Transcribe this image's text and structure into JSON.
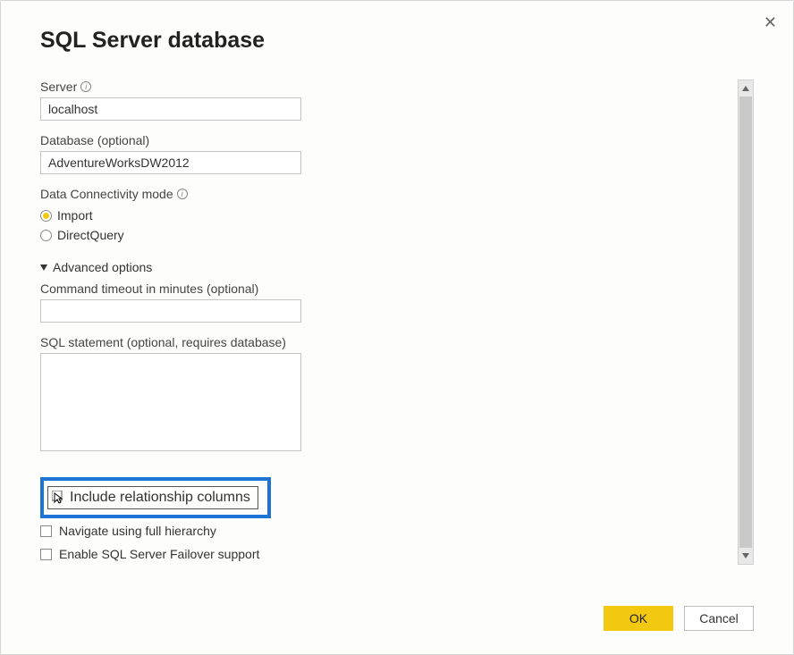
{
  "dialog": {
    "title": "SQL Server database"
  },
  "fields": {
    "server_label": "Server",
    "server_value": "localhost",
    "database_label": "Database (optional)",
    "database_value": "AdventureWorksDW2012",
    "connectivity_label": "Data Connectivity mode",
    "import_label": "Import",
    "directquery_label": "DirectQuery",
    "advanced_label": "Advanced options",
    "timeout_label": "Command timeout in minutes (optional)",
    "timeout_value": "",
    "sql_label": "SQL statement (optional, requires database)",
    "sql_value": "",
    "include_rel_label": "Include relationship columns",
    "navigate_label": "Navigate using full hierarchy",
    "failover_label": "Enable SQL Server Failover support"
  },
  "buttons": {
    "ok": "OK",
    "cancel": "Cancel"
  }
}
